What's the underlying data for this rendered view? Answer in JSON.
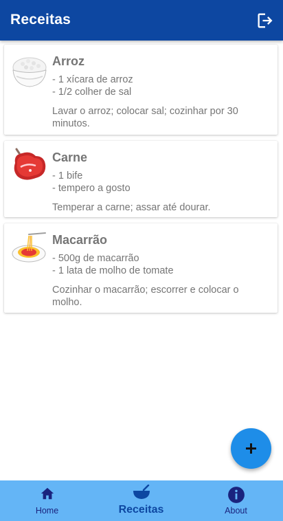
{
  "appbar": {
    "title": "Receitas",
    "logout_icon": "logout-icon"
  },
  "recipes": [
    {
      "title": "Arroz",
      "ingredients": "- 1 xícara de arroz\n- 1/2 colher de sal",
      "preparation": "Lavar o arroz; colocar sal; cozinhar por 30 minutos.",
      "icon": "rice-bowl-icon"
    },
    {
      "title": "Carne",
      "ingredients": "- 1 bife\n- tempero a gosto",
      "preparation": "Temperar a carne; assar até dourar.",
      "icon": "steak-icon"
    },
    {
      "title": "Macarrão",
      "ingredients": "- 500g de macarrão\n- 1 lata de molho de tomate",
      "preparation": "Cozinhar o macarrão; escorrer e colocar o molho.",
      "icon": "spaghetti-icon"
    }
  ],
  "fab": {
    "icon": "plus-icon"
  },
  "bottom_nav": {
    "items": [
      {
        "label": "Home",
        "icon": "home-icon"
      },
      {
        "label": "Receitas",
        "icon": "bowl-icon",
        "active": true
      },
      {
        "label": "About",
        "icon": "info-icon"
      }
    ]
  },
  "colors": {
    "primary": "#0d47a1",
    "nav_bg": "#64b5f6",
    "fab": "#1e8de8",
    "text": "#757575"
  }
}
